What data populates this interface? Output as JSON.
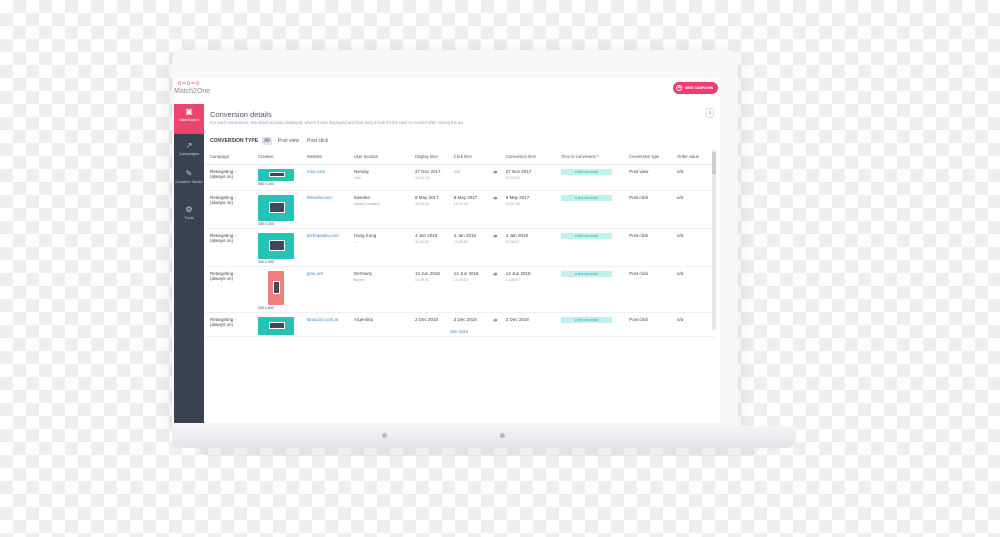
{
  "app": {
    "logo_text": "Match2One",
    "new_campaign_label": "NEW CAMPAIGN"
  },
  "sidebar": {
    "items": [
      {
        "label": "Dashboard",
        "icon": "dashboard-icon",
        "active": true
      },
      {
        "label": "Campaigns",
        "icon": "chart-icon",
        "active": false
      },
      {
        "label": "Creative Studio",
        "icon": "pen-icon",
        "active": false
      },
      {
        "label": "Tools",
        "icon": "wrench-icon",
        "active": false
      }
    ]
  },
  "panel": {
    "title": "Conversion details",
    "subtitle": "For each conversion, see which ad was displayed, where it was displayed and how long it took for the user to convert after seeing the ad.",
    "export_icon": "download-icon"
  },
  "filters": {
    "label": "CONVERSION TYPE",
    "options": [
      "All",
      "Post view",
      "Post click"
    ],
    "selected": "All"
  },
  "table": {
    "headers": [
      "Campaign",
      "Creative",
      "Website",
      "User location",
      "Display time",
      "Click time",
      "",
      "Conversion time",
      "Time to conversion ^",
      "Conversion type",
      "Order value"
    ],
    "rows": [
      {
        "campaign": "Retargeting - (always on)",
        "creative_size": "980 x 240",
        "website": "msn.com",
        "country": "Norway",
        "region": "Oslo",
        "display_date": "27 Nov 2017",
        "display_time": "10:03:18",
        "click_date": "n/a",
        "click_time": "",
        "conv_date": "27 Nov 2017",
        "conv_time": "10:03:29",
        "ttc": "a few seconds",
        "conv_type": "Post view",
        "order_value": "n/a"
      },
      {
        "campaign": "Retargeting - (always on)",
        "creative_size": "300 x 250",
        "website": "linkedin.com",
        "country": "Sweden",
        "region": "Vastra Gotaland",
        "display_date": "8 May 2017",
        "display_time": "15:06:14",
        "click_date": "8 May 2017",
        "click_time": "15:07:29",
        "conv_date": "8 May 2017",
        "conv_time": "15:07:36",
        "ttc": "a few seconds",
        "conv_type": "Post click",
        "order_value": "n/a"
      },
      {
        "campaign": "Retargeting - (always on)",
        "creative_size": "300 x 250",
        "website": "techopedia.com",
        "country": "Hong Kong",
        "region": "—",
        "display_date": "4 Jan 2019",
        "display_time": "11:04:05",
        "click_date": "4 Jan 2019",
        "click_time": "11:05:43",
        "conv_date": "4 Jan 2019",
        "conv_time": "11:36:17",
        "ttc": "a few seconds",
        "conv_type": "Post click",
        "order_value": "n/a"
      },
      {
        "campaign": "Retargeting - (always on)",
        "creative_size": "300 x 600",
        "website": "gmx.net",
        "country": "Germany",
        "region": "Bayern",
        "display_date": "14 Jun 2018",
        "display_time": "14:29:01",
        "click_date": "14 Jun 2018",
        "click_time": "14:29:33",
        "conv_date": "14 Jun 2018",
        "conv_time": "14:30:17",
        "ttc": "a few seconds",
        "conv_type": "Post click",
        "order_value": "n/a"
      },
      {
        "campaign": "Retargeting - (always on)",
        "creative_size": "",
        "website": "lanacion.com.ar",
        "country": "Argentina",
        "region": "",
        "display_date": "2 Dec 2018",
        "display_time": "",
        "click_date": "2 Dec 2018",
        "click_time": "",
        "conv_date": "2 Dec 2018",
        "conv_time": "",
        "ttc": "a few seconds",
        "conv_type": "Post click",
        "order_value": "n/a"
      }
    ],
    "see_more": "See more"
  }
}
